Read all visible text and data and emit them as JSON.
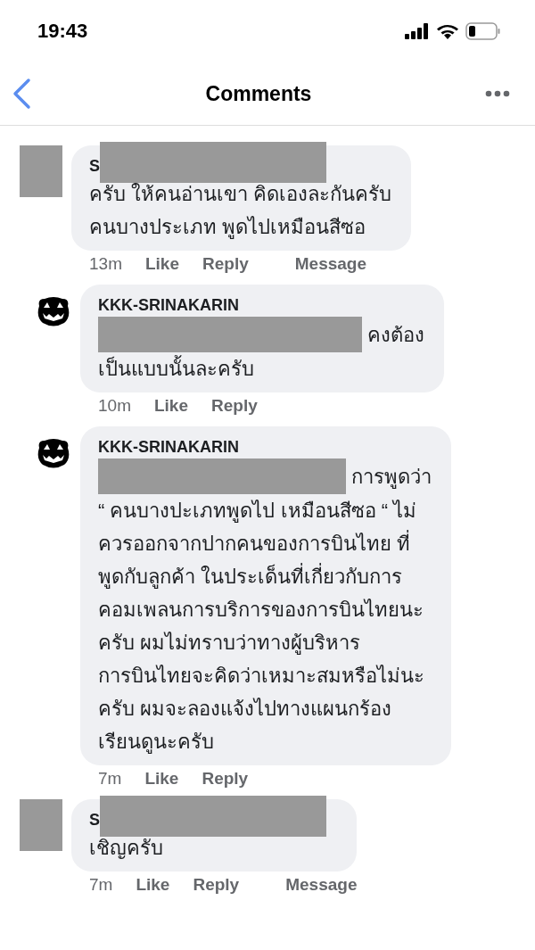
{
  "status_bar": {
    "time": "19:43"
  },
  "header": {
    "title": "Comments"
  },
  "comments": [
    {
      "kind": "redacted",
      "name": "S",
      "body": "ครับ  ให้คนอ่านเขา คิดเองละกันครับ\nคนบางประเภท พูดไปเหมือนสีซอ",
      "time": "13m",
      "actions": [
        "Like",
        "Reply",
        "Message"
      ]
    },
    {
      "kind": "pumpkin",
      "name": "KKK-SRINAKARIN",
      "lead_text": "คงต้อง",
      "body": "เป็นแบบนั้นละครับ",
      "time": "10m",
      "actions": [
        "Like",
        "Reply"
      ]
    },
    {
      "kind": "pumpkin",
      "name": "KKK-SRINAKARIN",
      "lead_text": "การพูดว่า",
      "body": "“ คนบางปะเภทพูดไป เหมือนสีซอ “ ไม่\nควรออกจากปากคนของการบินไทย ที่\nพูดกับลูกค้า ในประเด็นที่เกี่ยวกับการ\nคอมเพลนการบริการของการบินไทยนะ\nครับ ผมไม่ทราบว่าทางผู้บริหาร\nการบินไทยจะคิดว่าเหมาะสมหรือไม่นะ\nครับ ผมจะลองแจ้งไปทางแผนกร้อง\nเรียนดูนะครับ",
      "time": "7m",
      "actions": [
        "Like",
        "Reply"
      ]
    },
    {
      "kind": "redacted",
      "name": "S",
      "body": "เชิญครับ",
      "time": "7m",
      "actions": [
        "Like",
        "Reply",
        "Message"
      ]
    }
  ]
}
